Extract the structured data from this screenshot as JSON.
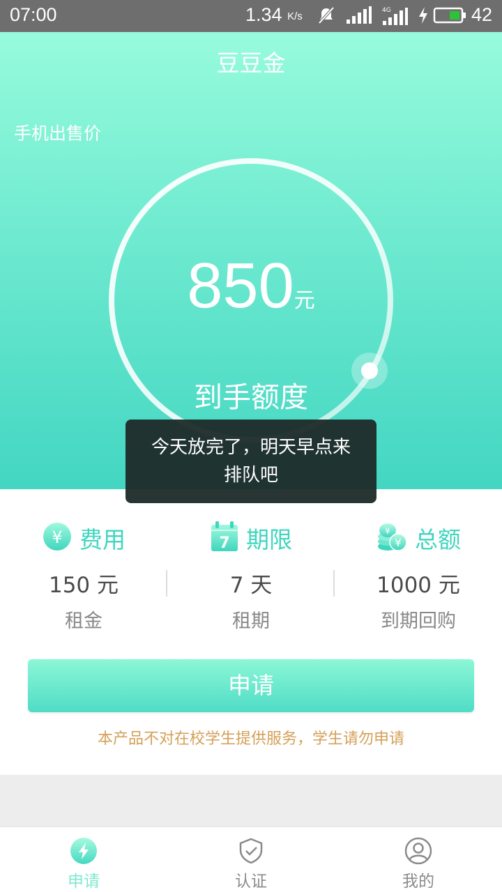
{
  "status_bar": {
    "time": "07:00",
    "speed": "1.34",
    "speed_unit": "K/s",
    "signal_label": "4G",
    "battery": "42"
  },
  "app": {
    "title": "豆豆金",
    "price_label": "手机出售价",
    "amount": "850",
    "amount_unit": "元",
    "amount_label": "到手额度"
  },
  "toast": {
    "line1": "今天放完了，明天早点来",
    "line2": "排队吧"
  },
  "info": {
    "fee": {
      "title": "费用",
      "value": "150 元",
      "sub": "租金",
      "icon": "yen-coin-icon"
    },
    "term": {
      "title": "期限",
      "value": "7 天",
      "sub": "租期",
      "icon": "calendar-icon",
      "icon_text": "7"
    },
    "total": {
      "title": "总额",
      "value": "1000 元",
      "sub": "到期回购",
      "icon": "coin-stack-icon"
    }
  },
  "apply_button": "申请",
  "notice": "本产品不对在校学生提供服务，学生请勿申请",
  "nav": {
    "items": [
      {
        "label": "申请",
        "icon": "lightning-icon",
        "active": true
      },
      {
        "label": "认证",
        "icon": "shield-check-icon",
        "active": false
      },
      {
        "label": "我的",
        "icon": "user-icon",
        "active": false
      }
    ]
  },
  "colors": {
    "accent": "#3fd6be",
    "notice": "#d4a059",
    "nav_inactive": "#8a8a8a"
  }
}
